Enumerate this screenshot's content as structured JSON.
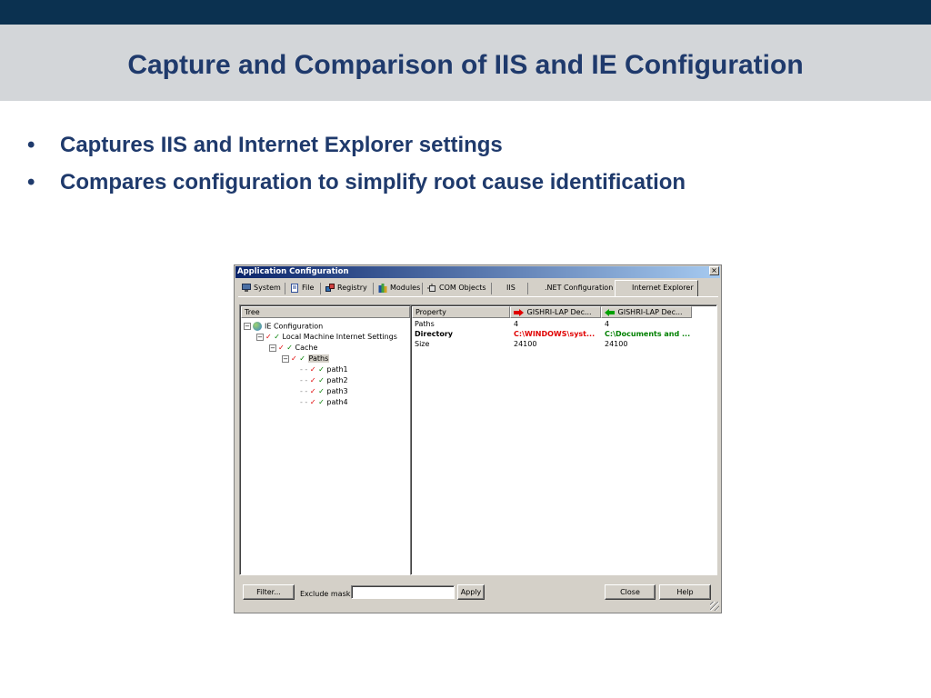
{
  "slide": {
    "title": "Capture and Comparison of IIS and IE Configuration",
    "bullets": [
      "Captures IIS and Internet Explorer settings",
      "Compares configuration to simplify root cause identification"
    ],
    "bullet_char": "•"
  },
  "window": {
    "title": "Application Configuration",
    "close_glyph": "×",
    "tabs": [
      {
        "label": "System",
        "icon": "computer-icon"
      },
      {
        "label": "File",
        "icon": "file-icon"
      },
      {
        "label": "Registry",
        "icon": "registry-icon"
      },
      {
        "label": "Modules",
        "icon": "modules-icon"
      },
      {
        "label": "COM Objects",
        "icon": "com-objects-icon"
      },
      {
        "label": "IIS",
        "icon": ""
      },
      {
        "label": ".NET Configuration",
        "icon": ""
      },
      {
        "label": "Internet Explorer",
        "icon": "",
        "active": true
      }
    ],
    "tree": {
      "header": "Tree",
      "nodes": [
        {
          "label": "IE Configuration",
          "expander": "−",
          "icon": "globe-icon"
        },
        {
          "label": "Local Machine Internet Settings",
          "expander": "−",
          "checks": "✓ ✓"
        },
        {
          "label": "Cache",
          "expander": "−",
          "checks": "✓ ✓"
        },
        {
          "label": "Paths",
          "expander": "−",
          "checks": "✓ ✓",
          "selected": true
        },
        {
          "label": "path1",
          "checks": "✓ ✓"
        },
        {
          "label": "path2",
          "checks": "✓ ✓"
        },
        {
          "label": "path3",
          "checks": "✓ ✓"
        },
        {
          "label": "path4",
          "checks": "✓ ✓"
        }
      ]
    },
    "details": {
      "columns": [
        {
          "label": "Property",
          "icon": ""
        },
        {
          "label": "GISHRI-LAP Dec...",
          "icon": "red-right-arrow-icon"
        },
        {
          "label": "GISHRI-LAP Dec...",
          "icon": "green-left-arrow-icon"
        }
      ],
      "rows": [
        {
          "property": "Paths",
          "left": "4",
          "right": "4",
          "diff": false
        },
        {
          "property": "Directory",
          "left": "C:\\WINDOWS\\syst...",
          "right": "C:\\Documents and ...",
          "diff": true
        },
        {
          "property": "Size",
          "left": "24100",
          "right": "24100",
          "diff": false
        }
      ]
    },
    "footer": {
      "filter_label": "Filter...",
      "exclude_mask_label": "Exclude mask:",
      "exclude_mask_value": "",
      "apply_label": "Apply",
      "close_label": "Close",
      "help_label": "Help"
    }
  },
  "colors": {
    "topbar": "#0b3150",
    "title_band": "#d3d6d9",
    "title_text": "#1f3a6c",
    "window_face": "#d4d0c8",
    "diff_left": "#e00000",
    "diff_right": "#008000"
  }
}
